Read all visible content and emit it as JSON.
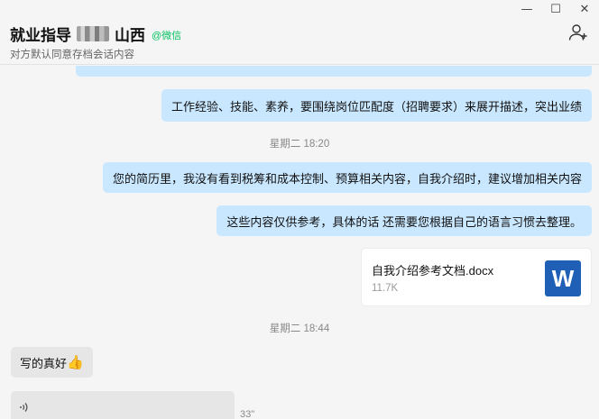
{
  "window": {
    "minimize": "—",
    "maximize": "☐",
    "close": "✕"
  },
  "header": {
    "title_prefix": "就业指导",
    "title_suffix": "山西",
    "wechat_tag": "@微信",
    "subtitle": "对方默认同意存档会话内容"
  },
  "messages": {
    "msg1": "工作经验、技能、素养，要围绕岗位匹配度（招聘要求）来展开描述，突出业绩",
    "time1": "星期二 18:20",
    "msg2": "您的简历里，我没有看到税筹和成本控制、预算相关内容，自我介绍时，建议增加相关内容",
    "msg3": "这些内容仅供参考，具体的话 还需要您根据自己的语言习惯去整理。",
    "file_name": "自我介绍参考文档.docx",
    "file_size": "11.7K",
    "file_icon_letter": "W",
    "time2": "星期二 18:44",
    "reply": "写的真好",
    "reply_emoji": "👍",
    "voice_length": "33\""
  },
  "colors": {
    "bubble_self": "#c9e7ff",
    "bubble_other": "#e6e6e6",
    "wechat_green": "#07c160",
    "word_blue": "#1f5fb6"
  }
}
